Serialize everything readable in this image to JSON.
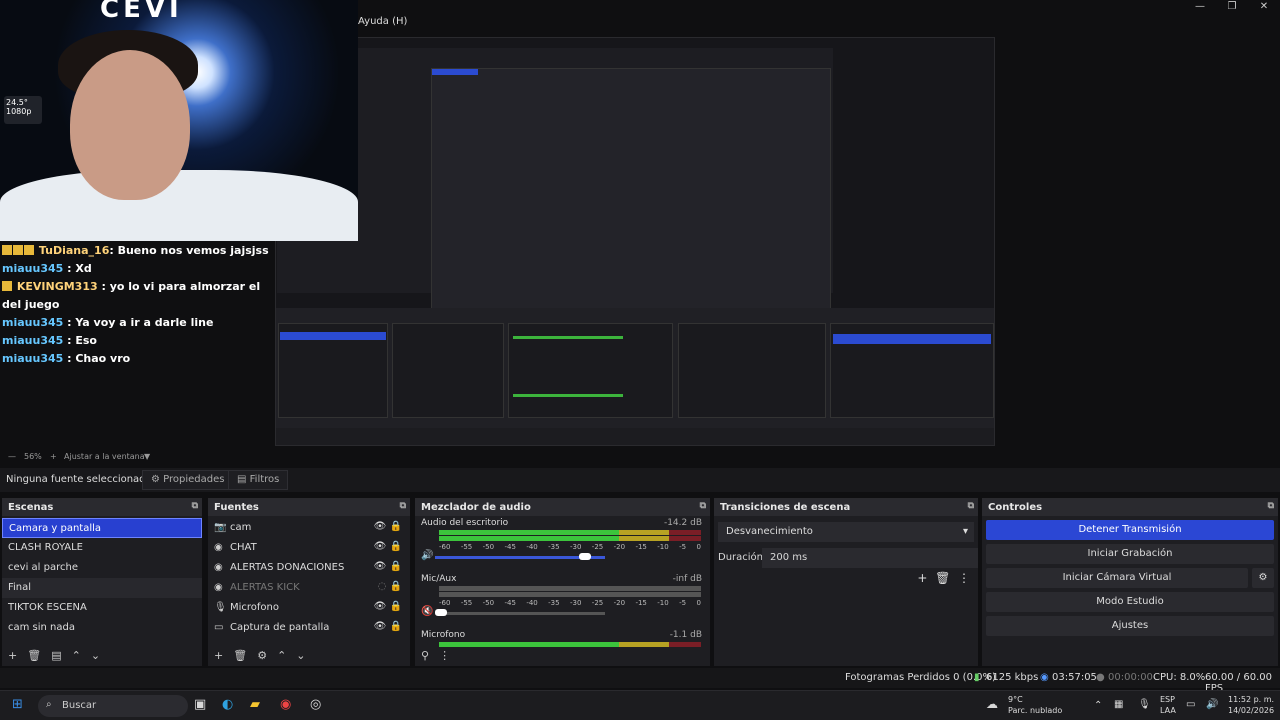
{
  "window": {
    "menu_help": "Ayuda (H)"
  },
  "webcam": {
    "banner": "CEVI",
    "fps_overlay": "24.5° 1080p"
  },
  "chat": [
    {
      "user": "TuDiana_16",
      "text": "Bueno nos vemos jajsjss"
    },
    {
      "user": "miauu345",
      "text": "Xd"
    },
    {
      "user": "KEVINGM313",
      "text": "yo lo vi para almorzar el del juego"
    },
    {
      "user": "miauu345",
      "text": "Ya voy a ir a darle line"
    },
    {
      "user": "miauu345",
      "text": "Eso"
    },
    {
      "user": "miauu345",
      "text": "Chao vro"
    }
  ],
  "zoom": {
    "value": "56%",
    "fit": "Ajustar a la ventana"
  },
  "source_bar": {
    "label": "Ninguna fuente seleccionad",
    "properties": "Propiedades",
    "filters": "Filtros"
  },
  "scenes": {
    "title": "Escenas",
    "items": [
      "Camara y pantalla",
      "CLASH ROYALE",
      "cevi al parche",
      "Final",
      "TIKTOK ESCENA",
      "cam sin nada"
    ]
  },
  "sources": {
    "title": "Fuentes",
    "items": [
      "cam",
      "CHAT",
      "ALERTAS DONACIONES",
      "ALERTAS KICK",
      "Microfono",
      "Captura de pantalla"
    ]
  },
  "mixer": {
    "title": "Mezclador de audio",
    "channels": [
      {
        "name": "Audio del escritorio",
        "db": "-14.2 dB",
        "level": 0.72
      },
      {
        "name": "Mic/Aux",
        "db": "-inf dB",
        "level": 0.0
      },
      {
        "name": "Microfono",
        "db": "-1.1 dB",
        "level": 0.72
      }
    ],
    "ticks": [
      "-60",
      "-55",
      "-50",
      "-45",
      "-40",
      "-35",
      "-30",
      "-25",
      "-20",
      "-15",
      "-10",
      "-5",
      "0"
    ]
  },
  "transitions": {
    "title": "Transiciones de escena",
    "type": "Desvanecimiento",
    "duration_label": "Duración",
    "duration_value": "200 ms"
  },
  "controls": {
    "title": "Controles",
    "stop_stream": "Detener Transmisión",
    "start_record": "Iniciar Grabación",
    "virtual_cam": "Iniciar Cámara Virtual",
    "studio_mode": "Modo Estudio",
    "settings": "Ajustes"
  },
  "status": {
    "dropped": "Fotogramas Perdidos 0 (0.0%)",
    "bitrate": "6125 kbps",
    "stream_time": "03:57:05",
    "record_time": "00:00:00",
    "cpu": "CPU: 8.0%",
    "fps": "60.00 / 60.00 FPS"
  },
  "taskbar": {
    "search": "Buscar",
    "weather_temp": "9°C",
    "weather_desc": "Parc. nublado",
    "lang1": "ESP",
    "lang2": "LAA",
    "time": "11:52 p. m.",
    "date": "14/02/2026"
  }
}
